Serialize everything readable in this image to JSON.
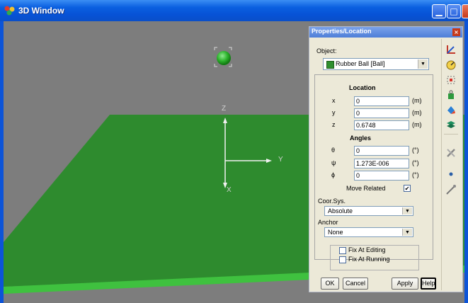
{
  "window": {
    "title": "3D Window"
  },
  "viewport": {
    "axis_labels": {
      "z": "Z",
      "y": "Y",
      "x": "X"
    },
    "colors": {
      "ground": "#2e8b2e",
      "ground_edge": "#3fc13f",
      "background": "#7d7d7d",
      "ball": "#2db42d"
    }
  },
  "panel": {
    "title": "Properties/Location",
    "object_label": "Object:",
    "object_value": "Rubber Ball  [Ball]",
    "location": {
      "heading": "Location",
      "rows": [
        {
          "label": "x",
          "value": "0",
          "unit": "(m)"
        },
        {
          "label": "y",
          "value": "0",
          "unit": "(m)"
        },
        {
          "label": "z",
          "value": "0.6748",
          "unit": "(m)"
        }
      ]
    },
    "angles": {
      "heading": "Angles",
      "rows": [
        {
          "label": "θ",
          "value": "0",
          "unit": "(°)"
        },
        {
          "label": "ψ",
          "value": "1.273E-006",
          "unit": "(°)"
        },
        {
          "label": "ϕ",
          "value": "0",
          "unit": "(°)"
        }
      ]
    },
    "move_related": {
      "label": "Move Related",
      "checked": "✔"
    },
    "coor_sys": {
      "label": "Coor.Sys.",
      "value": "Absolute"
    },
    "anchor": {
      "label": "Anchor",
      "value": "None"
    },
    "fix_editing": {
      "label": "Fix At Editing",
      "checked": ""
    },
    "fix_running": {
      "label": "Fix At Running",
      "checked": ""
    },
    "buttons": {
      "ok": "OK",
      "cancel": "Cancel",
      "apply": "Apply",
      "help": "Help"
    }
  },
  "toolbar_icons": [
    "axes-icon",
    "gauge-icon",
    "select-box-icon",
    "weight-icon",
    "paint-icon",
    "layers-icon",
    "tools-icon",
    "dot-icon",
    "probe-icon"
  ]
}
